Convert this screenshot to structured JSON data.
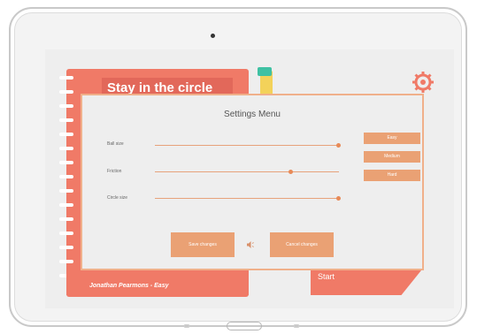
{
  "game": {
    "title": "Stay in the circle",
    "player_label": "Jonathan Pearmons - Easy",
    "start_label": "Start"
  },
  "settings": {
    "title": "Settings Menu",
    "rows": [
      {
        "label": "Ball size",
        "value": 1.0
      },
      {
        "label": "Friction",
        "value": 0.74
      },
      {
        "label": "Circle size",
        "value": 1.0
      }
    ],
    "difficulty": [
      "Easy",
      "Medium",
      "Hard"
    ],
    "save_label": "Save changes",
    "cancel_label": "Cancel changes"
  },
  "colors": {
    "primary": "#f07a67",
    "accent": "#eaa174"
  },
  "icons": {
    "settings": "gear-icon",
    "sound": "speaker-icon"
  }
}
